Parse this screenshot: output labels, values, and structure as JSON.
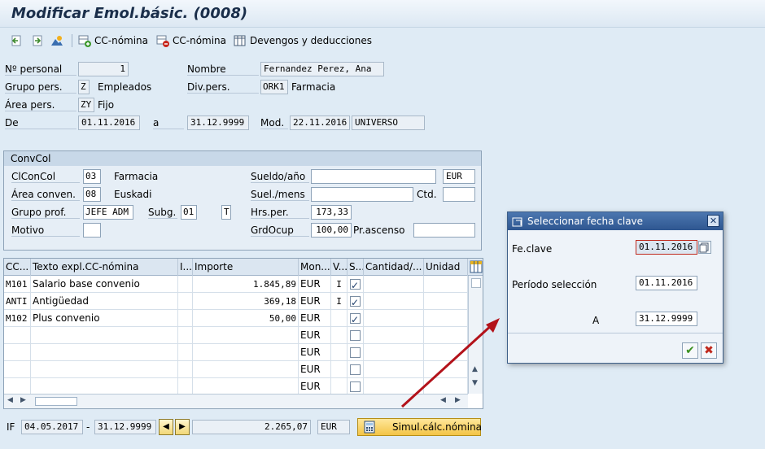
{
  "title": "Modificar Emol.básic. (0008)",
  "toolbar": {
    "ccnomina_add": "CC-nómina",
    "ccnomina_del": "CC-nómina",
    "devengos": "Devengos y deducciones"
  },
  "header": {
    "nper_label": "Nº personal",
    "nper_value": "1",
    "nombre_label": "Nombre",
    "nombre_value": "Fernandez Perez, Ana",
    "grupo_label": "Grupo pers.",
    "grupo_code": "Z",
    "grupo_text": "Empleados",
    "divpers_label": "Div.pers.",
    "divpers_code": "ORK1",
    "divpers_text": "Farmacia",
    "area_label": "Área pers.",
    "area_code": "ZY",
    "area_text": "Fijo",
    "de_label": "De",
    "de_value": "01.11.2016",
    "a_label": "a",
    "a_value": "31.12.9999",
    "mod_label": "Mod.",
    "mod_date": "22.11.2016",
    "mod_user": "UNIVERSO"
  },
  "convcol": {
    "title": "ConvCol",
    "clconcol_label": "ClConCol",
    "clconcol_code": "03",
    "clconcol_text": "Farmacia",
    "areaconv_label": "Área conven.",
    "areaconv_code": "08",
    "areaconv_text": "Euskadi",
    "grupoprof_label": "Grupo prof.",
    "grupoprof_value": "JEFE ADM",
    "subg_label": "Subg.",
    "subg_value": "01",
    "subg_extra": "T",
    "motivo_label": "Motivo",
    "motivo_value": "",
    "sueldo_label": "Sueldo/año",
    "sueldo_value": "",
    "sueldo_cur": "EUR",
    "suelmens_label": "Suel./mens",
    "suelmens_value": "",
    "ctd_label": "Ctd.",
    "ctd_value": "",
    "hrsper_label": "Hrs.per.",
    "hrsper_value": "173,33",
    "grdocup_label": "GrdOcup",
    "grdocup_value": "100,00",
    "prascenso_label": "Pr.ascenso",
    "prascenso_value": ""
  },
  "table": {
    "columns": [
      "CC...",
      "Texto expl.CC-nómina",
      "I...",
      "Importe",
      "Mon...",
      "V...",
      "S...",
      "Cantidad/...",
      "Unidad"
    ],
    "rows": [
      {
        "cc": "M101",
        "texto": "Salario base convenio",
        "importe": "1.845,89",
        "mon": "EUR",
        "v": "I",
        "s": true
      },
      {
        "cc": "ANTI",
        "texto": "Antigüedad",
        "importe": "369,18",
        "mon": "EUR",
        "v": "I",
        "s": true
      },
      {
        "cc": "M102",
        "texto": "Plus convenio",
        "importe": "50,00",
        "mon": "EUR",
        "v": "",
        "s": true
      },
      {
        "cc": "",
        "texto": "",
        "importe": "",
        "mon": "EUR",
        "v": "",
        "s": false
      },
      {
        "cc": "",
        "texto": "",
        "importe": "",
        "mon": "EUR",
        "v": "",
        "s": false
      },
      {
        "cc": "",
        "texto": "",
        "importe": "",
        "mon": "EUR",
        "v": "",
        "s": false
      },
      {
        "cc": "",
        "texto": "",
        "importe": "",
        "mon": "EUR",
        "v": "",
        "s": false
      }
    ]
  },
  "footer": {
    "if_label": "IF",
    "from": "04.05.2017",
    "dash": "-",
    "to": "31.12.9999",
    "total": "2.265,07",
    "cur": "EUR",
    "simul_label": "Simul.cálc.nómina"
  },
  "dialog": {
    "title": "Seleccionar fecha clave",
    "feclave_label": "Fe.clave",
    "feclave_value": "01.11.2016",
    "periodo_label": "Período selección",
    "periodo_value": "01.11.2016",
    "a_label": "A",
    "a_value": "31.12.9999"
  },
  "colors": {
    "accent": "#2e5690",
    "arrow": "#b3121a",
    "background": "#dfebf5"
  }
}
